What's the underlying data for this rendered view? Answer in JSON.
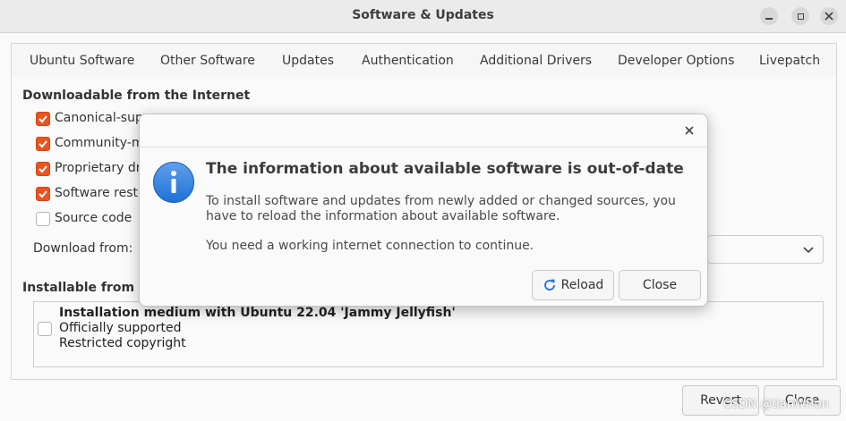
{
  "window": {
    "title": "Software & Updates"
  },
  "tabs": [
    {
      "label": "Ubuntu Software",
      "active": true
    },
    {
      "label": "Other Software"
    },
    {
      "label": "Updates"
    },
    {
      "label": "Authentication"
    },
    {
      "label": "Additional Drivers"
    },
    {
      "label": "Developer Options"
    },
    {
      "label": "Livepatch"
    }
  ],
  "internet_section": {
    "heading": "Downloadable from the Internet",
    "items": [
      {
        "label": "Canonical-supp",
        "checked": true
      },
      {
        "label": "Community-m",
        "checked": true
      },
      {
        "label": "Proprietary dr",
        "checked": true
      },
      {
        "label": "Software restr",
        "checked": true
      },
      {
        "label": "Source code",
        "checked": false
      }
    ],
    "download_from_label": "Download from:"
  },
  "cdrom_section": {
    "heading": "Installable from CI",
    "item": {
      "title": "Installation medium with Ubuntu 22.04 'Jammy Jellyfish'",
      "line2": "Officially supported",
      "line3": "Restricted copyright",
      "checked": false
    }
  },
  "bottom_buttons": {
    "revert": "Revert",
    "close": "Close"
  },
  "watermark": "CSDN @tianWHon",
  "dialog": {
    "title": "The information about available software is out-of-date",
    "body": "To install software and updates from newly added or changed sources, you have to reload the information about available software.",
    "note": "You need a working internet connection to continue.",
    "reload_label": "Reload",
    "close_label": "Close",
    "icon": "info-icon"
  },
  "colors": {
    "accent": "#e95420",
    "info_blue": "#3584e4"
  }
}
